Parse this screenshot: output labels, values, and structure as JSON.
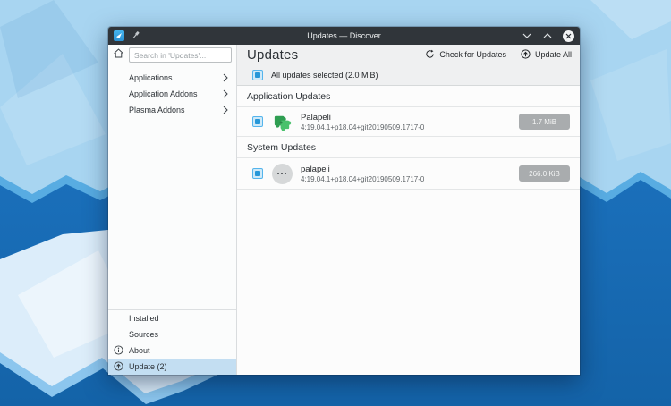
{
  "theme": {
    "accent_blue": "#3daee9",
    "titlebar_bg": "#30353a",
    "selection_bg": "#c3def2",
    "header_bg": "#eff0f1",
    "surface": "#fcfcfc",
    "badge_bg": "#a9acae"
  },
  "window": {
    "title": "Updates — Discover",
    "icons": {
      "app": "discover-app-icon",
      "pin": "pin-icon",
      "minimize": "chevron-down",
      "maximize": "chevron-up",
      "close": "close-x-in-circle"
    }
  },
  "sidebar": {
    "search": {
      "placeholder": "Search in 'Updates'...",
      "value": ""
    },
    "home_icon": "home-icon",
    "top_items": [
      {
        "label": "Applications"
      },
      {
        "label": "Application Addons"
      },
      {
        "label": "Plasma Addons"
      }
    ],
    "bottom_items": [
      {
        "label": "Installed"
      },
      {
        "label": "Sources"
      },
      {
        "label": "About",
        "icon": "info-icon"
      },
      {
        "label": "Update (2)",
        "icon": "update-icon",
        "selected": true
      }
    ]
  },
  "header": {
    "title": "Updates",
    "check_label": "Check for Updates",
    "check_icon": "refresh-icon",
    "update_all_label": "Update All",
    "update_all_icon": "update-icon"
  },
  "summary": {
    "label": "All updates selected (2.0 MiB)",
    "checked": true
  },
  "sections": [
    {
      "title": "Application Updates",
      "rows": [
        {
          "name": "Palapeli",
          "version": "4:19.04.1+p18.04+git20190509.1717-0",
          "size": "1.7 MiB",
          "icon": "palapeli-puzzle-icon",
          "checked": true
        }
      ]
    },
    {
      "title": "System Updates",
      "rows": [
        {
          "name": "palapeli",
          "version": "4:19.04.1+p18.04+git20190509.1717-0",
          "size": "266.0 KiB",
          "icon": "generic-package-icon",
          "checked": true
        }
      ]
    }
  ]
}
